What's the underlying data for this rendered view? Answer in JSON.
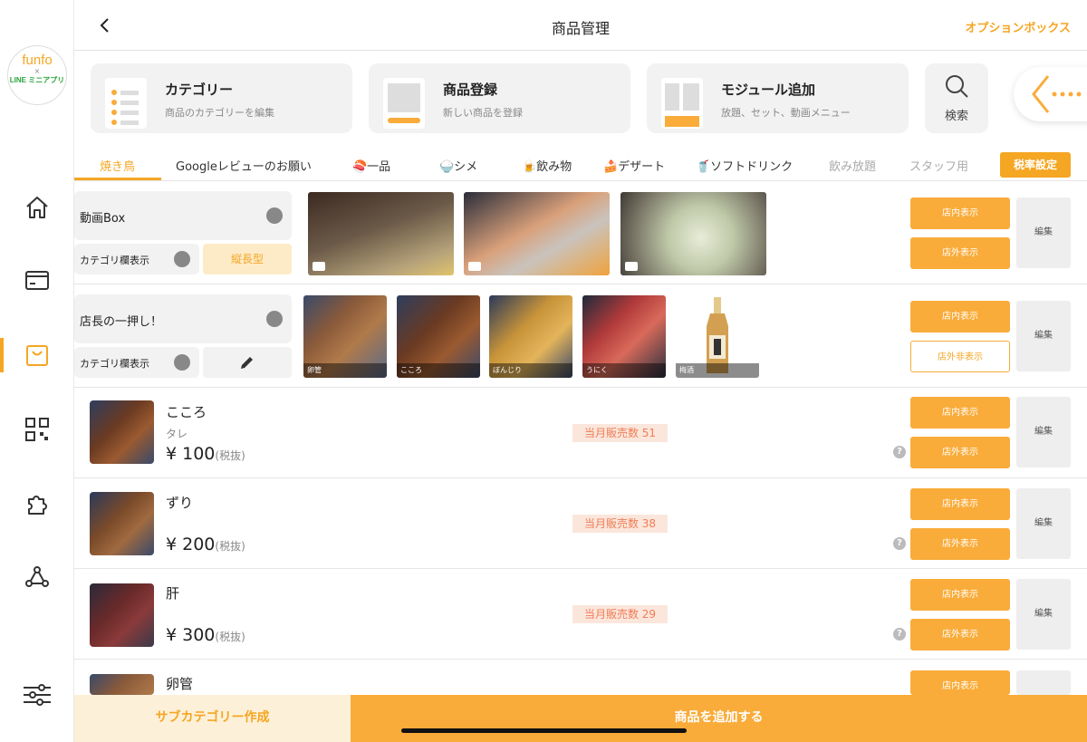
{
  "app": {
    "logo_line1": "funfo",
    "logo_line2": "×",
    "logo_line3": "LINE ミニアプリ"
  },
  "header": {
    "title": "商品管理",
    "option_box": "オプションボックス"
  },
  "cards": [
    {
      "title": "カテゴリー",
      "subtitle": "商品のカテゴリーを編集"
    },
    {
      "title": "商品登録",
      "subtitle": "新しい商品を登録"
    },
    {
      "title": "モジュール追加",
      "subtitle": "放題、セット、動画メニュー"
    }
  ],
  "search": {
    "label": "検索"
  },
  "tabs": [
    {
      "label": "焼き鳥",
      "state": "active"
    },
    {
      "label": "Googleレビューのお願い",
      "state": "normal"
    },
    {
      "label": "🍣一品",
      "state": "normal"
    },
    {
      "label": "🍚シメ",
      "state": "normal"
    },
    {
      "label": "🍺飲み物",
      "state": "normal"
    },
    {
      "label": "🍰デザート",
      "state": "normal"
    },
    {
      "label": "🥤ソフトドリンク",
      "state": "normal"
    },
    {
      "label": "飲み放題",
      "state": "dim"
    },
    {
      "label": "スタッフ用",
      "state": "dim"
    }
  ],
  "tax_button": "税率設定",
  "module_video": {
    "label": "動画Box",
    "category_display": "カテゴリ欄表示",
    "type_button": "縦長型",
    "btn_in_store": "店内表示",
    "btn_out_store": "店外表示",
    "btn_edit": "編集"
  },
  "module_recommend": {
    "label": "店長の一押し！",
    "category_display": "カテゴリ欄表示",
    "thumbs": [
      "卵管",
      "こころ",
      "ぼんじり",
      "うにく",
      "梅酒"
    ],
    "btn_in_store": "店内表示",
    "btn_out_store": "店外非表示",
    "btn_edit": "編集"
  },
  "products": [
    {
      "name": "こころ",
      "sub": "タレ",
      "price": "¥ 100",
      "tax": "(税抜)",
      "sales": "当月販売数 51",
      "btn_in": "店内表示",
      "btn_out": "店外表示",
      "btn_edit": "編集"
    },
    {
      "name": "ずり",
      "sub": "",
      "price": "¥ 200",
      "tax": "(税抜)",
      "sales": "当月販売数 38",
      "btn_in": "店内表示",
      "btn_out": "店外表示",
      "btn_edit": "編集"
    },
    {
      "name": "肝",
      "sub": "",
      "price": "¥ 300",
      "tax": "(税抜)",
      "sales": "当月販売数 29",
      "btn_in": "店内表示",
      "btn_out": "店外表示",
      "btn_edit": "編集"
    },
    {
      "name": "卵管",
      "btn_in": "店内表示"
    }
  ],
  "bottom": {
    "subcategory": "サブカテゴリー作成",
    "add_product": "商品を追加する"
  },
  "help_mark": "?",
  "colors": {
    "accent": "#f9ac3a",
    "accent_text": "#f5a623",
    "sales_bg": "#fbe6dc",
    "sales_text": "#f07d55"
  }
}
